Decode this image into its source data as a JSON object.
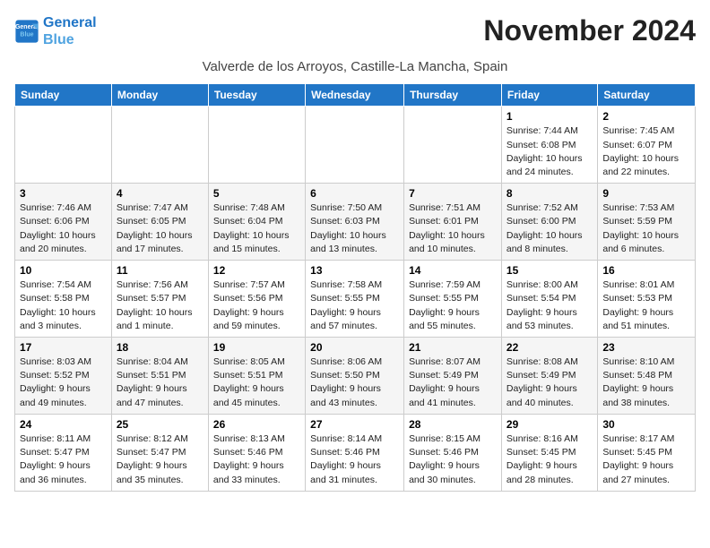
{
  "logo": {
    "line1": "General",
    "line2": "Blue"
  },
  "title": "November 2024",
  "location": "Valverde de los Arroyos, Castille-La Mancha, Spain",
  "weekdays": [
    "Sunday",
    "Monday",
    "Tuesday",
    "Wednesday",
    "Thursday",
    "Friday",
    "Saturday"
  ],
  "weeks": [
    [
      {
        "day": "",
        "info": ""
      },
      {
        "day": "",
        "info": ""
      },
      {
        "day": "",
        "info": ""
      },
      {
        "day": "",
        "info": ""
      },
      {
        "day": "",
        "info": ""
      },
      {
        "day": "1",
        "info": "Sunrise: 7:44 AM\nSunset: 6:08 PM\nDaylight: 10 hours and 24 minutes."
      },
      {
        "day": "2",
        "info": "Sunrise: 7:45 AM\nSunset: 6:07 PM\nDaylight: 10 hours and 22 minutes."
      }
    ],
    [
      {
        "day": "3",
        "info": "Sunrise: 7:46 AM\nSunset: 6:06 PM\nDaylight: 10 hours and 20 minutes."
      },
      {
        "day": "4",
        "info": "Sunrise: 7:47 AM\nSunset: 6:05 PM\nDaylight: 10 hours and 17 minutes."
      },
      {
        "day": "5",
        "info": "Sunrise: 7:48 AM\nSunset: 6:04 PM\nDaylight: 10 hours and 15 minutes."
      },
      {
        "day": "6",
        "info": "Sunrise: 7:50 AM\nSunset: 6:03 PM\nDaylight: 10 hours and 13 minutes."
      },
      {
        "day": "7",
        "info": "Sunrise: 7:51 AM\nSunset: 6:01 PM\nDaylight: 10 hours and 10 minutes."
      },
      {
        "day": "8",
        "info": "Sunrise: 7:52 AM\nSunset: 6:00 PM\nDaylight: 10 hours and 8 minutes."
      },
      {
        "day": "9",
        "info": "Sunrise: 7:53 AM\nSunset: 5:59 PM\nDaylight: 10 hours and 6 minutes."
      }
    ],
    [
      {
        "day": "10",
        "info": "Sunrise: 7:54 AM\nSunset: 5:58 PM\nDaylight: 10 hours and 3 minutes."
      },
      {
        "day": "11",
        "info": "Sunrise: 7:56 AM\nSunset: 5:57 PM\nDaylight: 10 hours and 1 minute."
      },
      {
        "day": "12",
        "info": "Sunrise: 7:57 AM\nSunset: 5:56 PM\nDaylight: 9 hours and 59 minutes."
      },
      {
        "day": "13",
        "info": "Sunrise: 7:58 AM\nSunset: 5:55 PM\nDaylight: 9 hours and 57 minutes."
      },
      {
        "day": "14",
        "info": "Sunrise: 7:59 AM\nSunset: 5:55 PM\nDaylight: 9 hours and 55 minutes."
      },
      {
        "day": "15",
        "info": "Sunrise: 8:00 AM\nSunset: 5:54 PM\nDaylight: 9 hours and 53 minutes."
      },
      {
        "day": "16",
        "info": "Sunrise: 8:01 AM\nSunset: 5:53 PM\nDaylight: 9 hours and 51 minutes."
      }
    ],
    [
      {
        "day": "17",
        "info": "Sunrise: 8:03 AM\nSunset: 5:52 PM\nDaylight: 9 hours and 49 minutes."
      },
      {
        "day": "18",
        "info": "Sunrise: 8:04 AM\nSunset: 5:51 PM\nDaylight: 9 hours and 47 minutes."
      },
      {
        "day": "19",
        "info": "Sunrise: 8:05 AM\nSunset: 5:51 PM\nDaylight: 9 hours and 45 minutes."
      },
      {
        "day": "20",
        "info": "Sunrise: 8:06 AM\nSunset: 5:50 PM\nDaylight: 9 hours and 43 minutes."
      },
      {
        "day": "21",
        "info": "Sunrise: 8:07 AM\nSunset: 5:49 PM\nDaylight: 9 hours and 41 minutes."
      },
      {
        "day": "22",
        "info": "Sunrise: 8:08 AM\nSunset: 5:49 PM\nDaylight: 9 hours and 40 minutes."
      },
      {
        "day": "23",
        "info": "Sunrise: 8:10 AM\nSunset: 5:48 PM\nDaylight: 9 hours and 38 minutes."
      }
    ],
    [
      {
        "day": "24",
        "info": "Sunrise: 8:11 AM\nSunset: 5:47 PM\nDaylight: 9 hours and 36 minutes."
      },
      {
        "day": "25",
        "info": "Sunrise: 8:12 AM\nSunset: 5:47 PM\nDaylight: 9 hours and 35 minutes."
      },
      {
        "day": "26",
        "info": "Sunrise: 8:13 AM\nSunset: 5:46 PM\nDaylight: 9 hours and 33 minutes."
      },
      {
        "day": "27",
        "info": "Sunrise: 8:14 AM\nSunset: 5:46 PM\nDaylight: 9 hours and 31 minutes."
      },
      {
        "day": "28",
        "info": "Sunrise: 8:15 AM\nSunset: 5:46 PM\nDaylight: 9 hours and 30 minutes."
      },
      {
        "day": "29",
        "info": "Sunrise: 8:16 AM\nSunset: 5:45 PM\nDaylight: 9 hours and 28 minutes."
      },
      {
        "day": "30",
        "info": "Sunrise: 8:17 AM\nSunset: 5:45 PM\nDaylight: 9 hours and 27 minutes."
      }
    ]
  ]
}
